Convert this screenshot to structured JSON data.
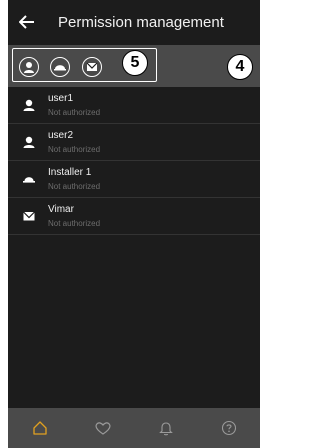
{
  "header": {
    "title": "Permission management",
    "back_icon": "arrow-left-icon"
  },
  "filter": {
    "icons": [
      "user-filter-icon",
      "installer-filter-icon",
      "vimar-filter-icon"
    ],
    "callout_filter": "5",
    "callout_bar": "4"
  },
  "users": [
    {
      "name": "user1",
      "status": "Not authorized",
      "icon": "user-icon"
    },
    {
      "name": "user2",
      "status": "Not authorized",
      "icon": "user-icon"
    },
    {
      "name": "Installer 1",
      "status": "Not authorized",
      "icon": "installer-hat-icon"
    },
    {
      "name": "Vimar",
      "status": "Not authorized",
      "icon": "vimar-envelope-icon"
    }
  ],
  "nav": {
    "items": [
      "home-icon",
      "heart-icon",
      "bell-icon",
      "help-icon"
    ],
    "active_color": "#e0a020",
    "inactive_color": "#9a9a9a"
  }
}
